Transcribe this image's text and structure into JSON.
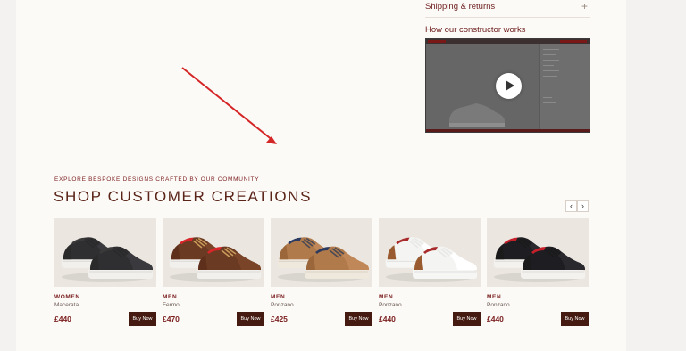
{
  "accordion": {
    "shipping_label": "Shipping & returns",
    "plus_glyph": "+"
  },
  "video": {
    "title": "How our constructor works"
  },
  "section": {
    "eyebrow": "EXPLORE BESPOKE DESIGNS CRAFTED BY OUR COMMUNITY",
    "heading": "SHOP CUSTOMER CREATIONS",
    "prev_glyph": "‹",
    "next_glyph": "›"
  },
  "colors": {
    "accent": "#7a1e1e",
    "button": "#451a10",
    "background": "#fcfaf7"
  },
  "products": [
    {
      "gender": "WOMEN",
      "model": "Macerata",
      "price": "£440",
      "buy_label": "Buy Now",
      "shoe": {
        "upper": "#2f2f32",
        "toe": "#3a3a3e",
        "sole": "#f2f0ec",
        "lace": "#2a2a2a",
        "heel": "#2a2a2a",
        "lining": "#3a3a3a"
      }
    },
    {
      "gender": "MEN",
      "model": "Fermo",
      "price": "£470",
      "buy_label": "Buy Now",
      "shoe": {
        "upper": "#6b3a22",
        "toe": "#7a4429",
        "sole": "#f2f0ec",
        "lace": "#c79a5a",
        "heel": "#5e2f1a",
        "lining": "#d8262b"
      }
    },
    {
      "gender": "MEN",
      "model": "Ponzano",
      "price": "£425",
      "buy_label": "Buy Now",
      "shoe": {
        "upper": "#b07a4a",
        "toe": "#c08858",
        "sole": "#efe8dc",
        "lace": "#4a4a56",
        "heel": "#9a663a",
        "lining": "#2a3a60"
      }
    },
    {
      "gender": "MEN",
      "model": "Ponzano",
      "price": "£440",
      "buy_label": "Buy Now",
      "shoe": {
        "upper": "#f4f4f2",
        "toe": "#ffffff",
        "sole": "#f6f6f4",
        "lace": "#e8e8e6",
        "heel": "#9a5a30",
        "lining": "#a82a2a"
      }
    },
    {
      "gender": "MEN",
      "model": "Ponzano",
      "price": "£440",
      "buy_label": "Buy Now",
      "shoe": {
        "upper": "#1e1e22",
        "toe": "#2a2a2e",
        "sole": "#f4f2ee",
        "lace": "#1a1a1a",
        "heel": "#1a1a1a",
        "lining": "#c8202a"
      }
    }
  ]
}
